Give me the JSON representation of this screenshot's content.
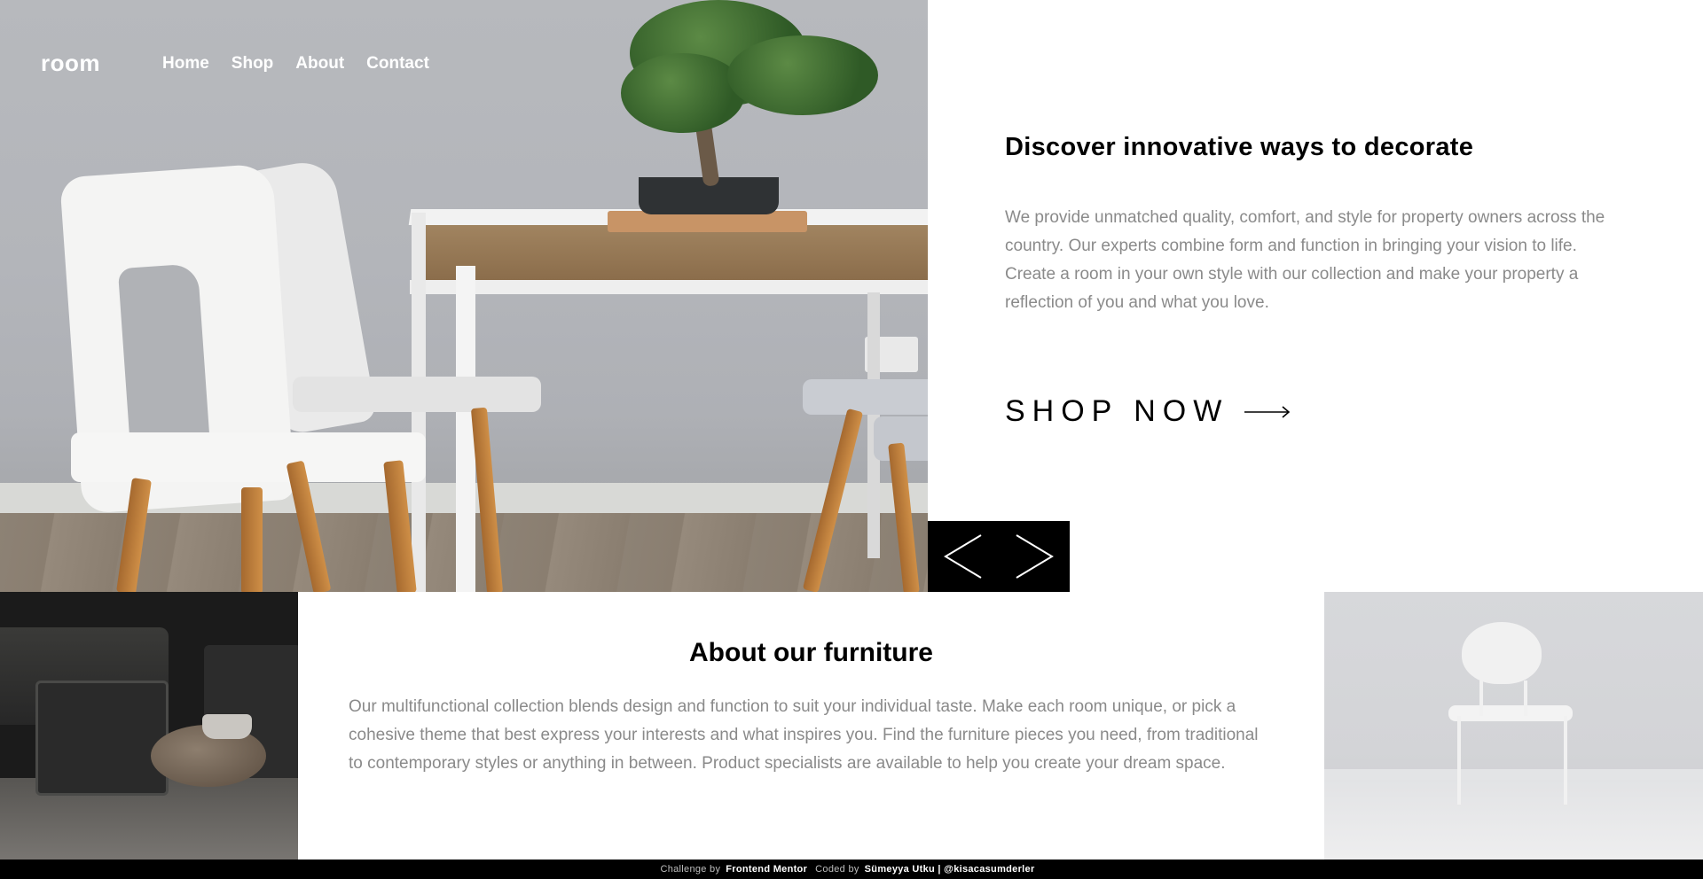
{
  "brand": {
    "logo": "room"
  },
  "nav": {
    "items": [
      {
        "label": "Home"
      },
      {
        "label": "Shop"
      },
      {
        "label": "About"
      },
      {
        "label": "Contact"
      }
    ]
  },
  "hero": {
    "title": "Discover innovative ways to decorate",
    "description": "We provide unmatched quality, comfort, and style for property owners across the country. Our experts combine form and function in bringing your vision to life. Create a room in your own style with our collection and make your property a reflection of you and what you love.",
    "cta_label": "SHOP NOW",
    "cta_icon": "arrow-right-icon"
  },
  "slider": {
    "prev_icon": "chevron-left-icon",
    "next_icon": "chevron-right-icon"
  },
  "about": {
    "title": "About our furniture",
    "description": "Our multifunctional collection blends design and function to suit your individual taste. Make each room unique, or pick a cohesive theme that best express your interests and what inspires you. Find the furniture pieces you need, from traditional to contemporary styles or anything in between. Product specialists are available to help you create your dream space."
  },
  "footer": {
    "challenge_prefix": "Challenge by",
    "challenge_link": "Frontend Mentor",
    "coded_prefix": "Coded by",
    "coded_link": "Sümeyya Utku | @kisacasumderler"
  },
  "colors": {
    "text_dark": "#000000",
    "text_muted": "#8a8a8a",
    "footer_bg": "#000000",
    "slider_bg": "#000000"
  }
}
